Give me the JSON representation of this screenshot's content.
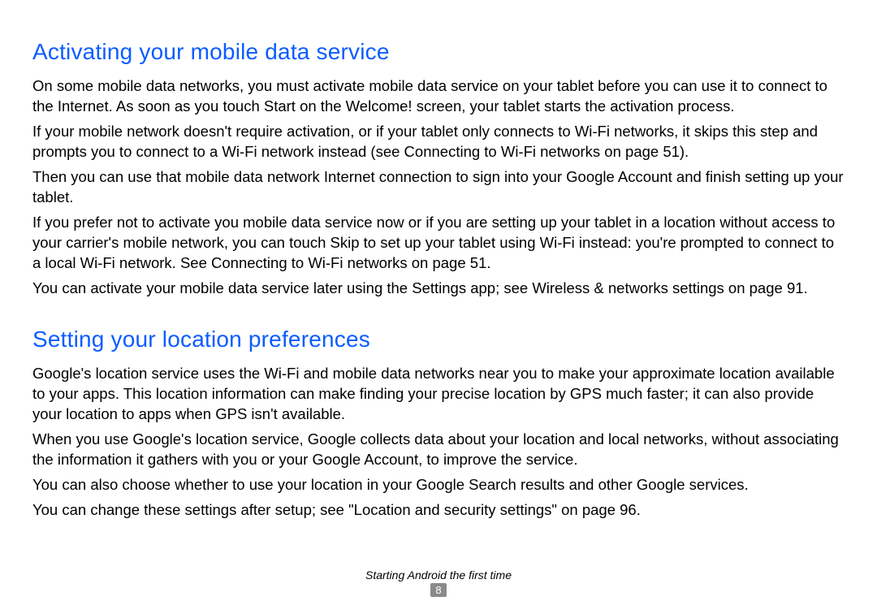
{
  "section1": {
    "title": "Activating your mobile data service",
    "p1": "On some mobile data networks, you must activate mobile data service on your tablet before you can use it to connect to the Internet. As soon as you touch Start on the Welcome! screen, your tablet starts the activation process.",
    "p2": "If your mobile network doesn't require activation, or if your tablet only connects to Wi-Fi networks, it skips this step and prompts you to connect to a Wi-Fi network instead (see Connecting to Wi-Fi networks on page 51).",
    "p3": "Then you can use that mobile data network Internet connection to sign into your Google Account and finish setting up your tablet.",
    "p4": "If you prefer not to activate you mobile data service now or if you are setting up your tablet in a location without access to your carrier's mobile network, you can touch Skip to set up your tablet using Wi-Fi instead: you're prompted to connect to a local Wi-Fi network. See Connecting to Wi-Fi networks on page 51.",
    "p5": "You can activate your mobile data service later using the Settings app; see Wireless & networks settings on page 91."
  },
  "section2": {
    "title": "Setting your location preferences",
    "p1": "Google's location service uses the Wi-Fi and mobile data networks near you to make your approximate location available to your apps. This location information can make finding your precise location by GPS much faster; it can also provide your location to apps when GPS isn't available.",
    "p2": "When you use Google's location service, Google collects data about your location and local networks, without associating the information it gathers with you or your Google Account, to improve the service.",
    "p3": "You can also choose whether to use your location in your Google Search results and other Google services.",
    "p4": "You can change these settings after setup; see \"Location and security settings\" on page 96."
  },
  "footer": {
    "breadcrumb": "Starting Android the first time",
    "page": "8"
  }
}
